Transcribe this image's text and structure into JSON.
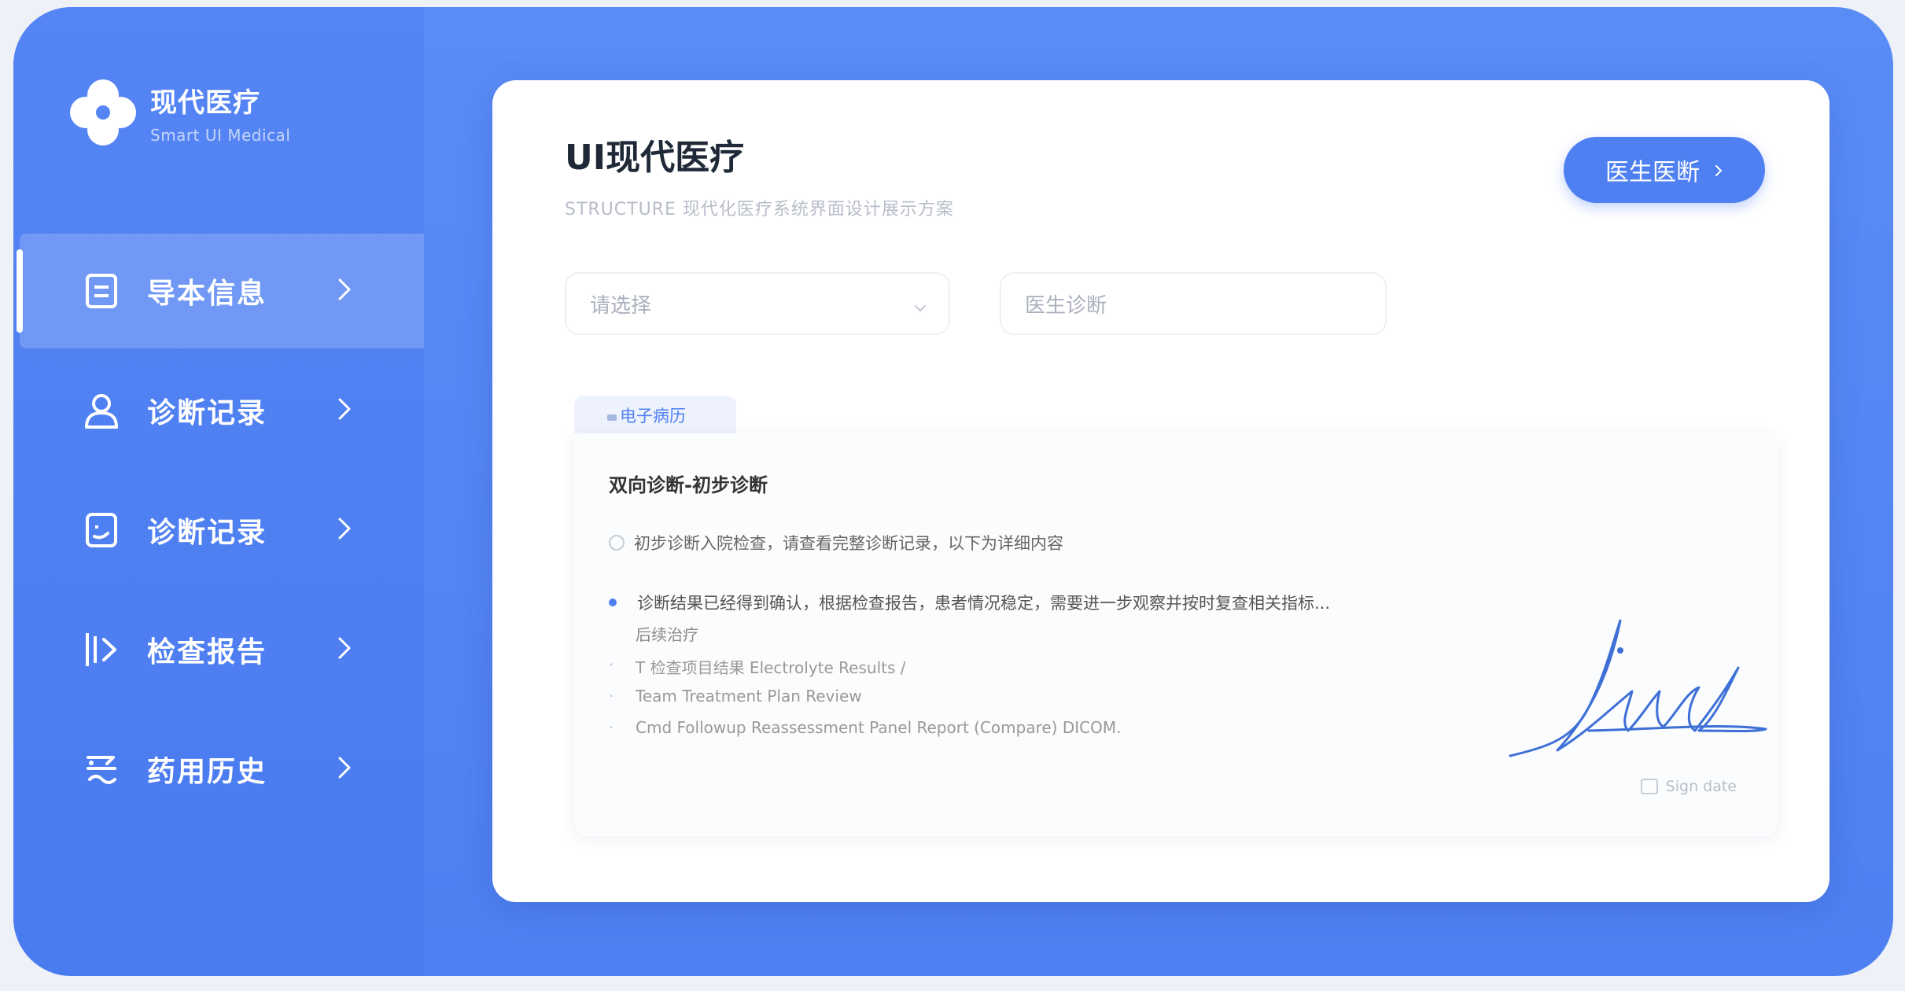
{
  "brand": {
    "name": "现代医疗",
    "subtitle": "Smart UI Medical"
  },
  "sidebar": {
    "items": [
      {
        "label": "导本信息",
        "icon": "document-icon",
        "active": true
      },
      {
        "label": "诊断记录",
        "icon": "user-icon",
        "active": false
      },
      {
        "label": "诊断记录",
        "icon": "patient-card-icon",
        "active": false
      },
      {
        "label": "检查报告",
        "icon": "report-icon",
        "active": false
      },
      {
        "label": "药用历史",
        "icon": "medicine-icon",
        "active": false
      }
    ]
  },
  "main": {
    "title": "UI现代医疗",
    "subtitle": "STRUCTURE 现代化医疗系统界面设计展示方案",
    "doctor_button": "医生医断",
    "select_placeholder": "请选择",
    "diagnosis_placeholder": "医生诊断",
    "tab_label": "电子病历",
    "record": {
      "title": "双向诊断-初步诊断",
      "note": "初步诊断入院检查，请查看完整诊断记录，以下为详细内容",
      "bullet": "诊断结果已经得到确认，根据检查报告，患者情况稳定，需要进一步观察并按时复查相关指标...",
      "bullet_sub": "后续治疗",
      "lines": [
        "T 检查项目结果 Electrolyte Results /",
        "Team Treatment Plan Review",
        "Cmd Followup Reassessment Panel Report (Compare) DICOM."
      ],
      "signature_label": "Sign date"
    }
  },
  "colors": {
    "primary": "#4f80f1",
    "sidebar": "#5585f4",
    "card": "#ffffff"
  }
}
